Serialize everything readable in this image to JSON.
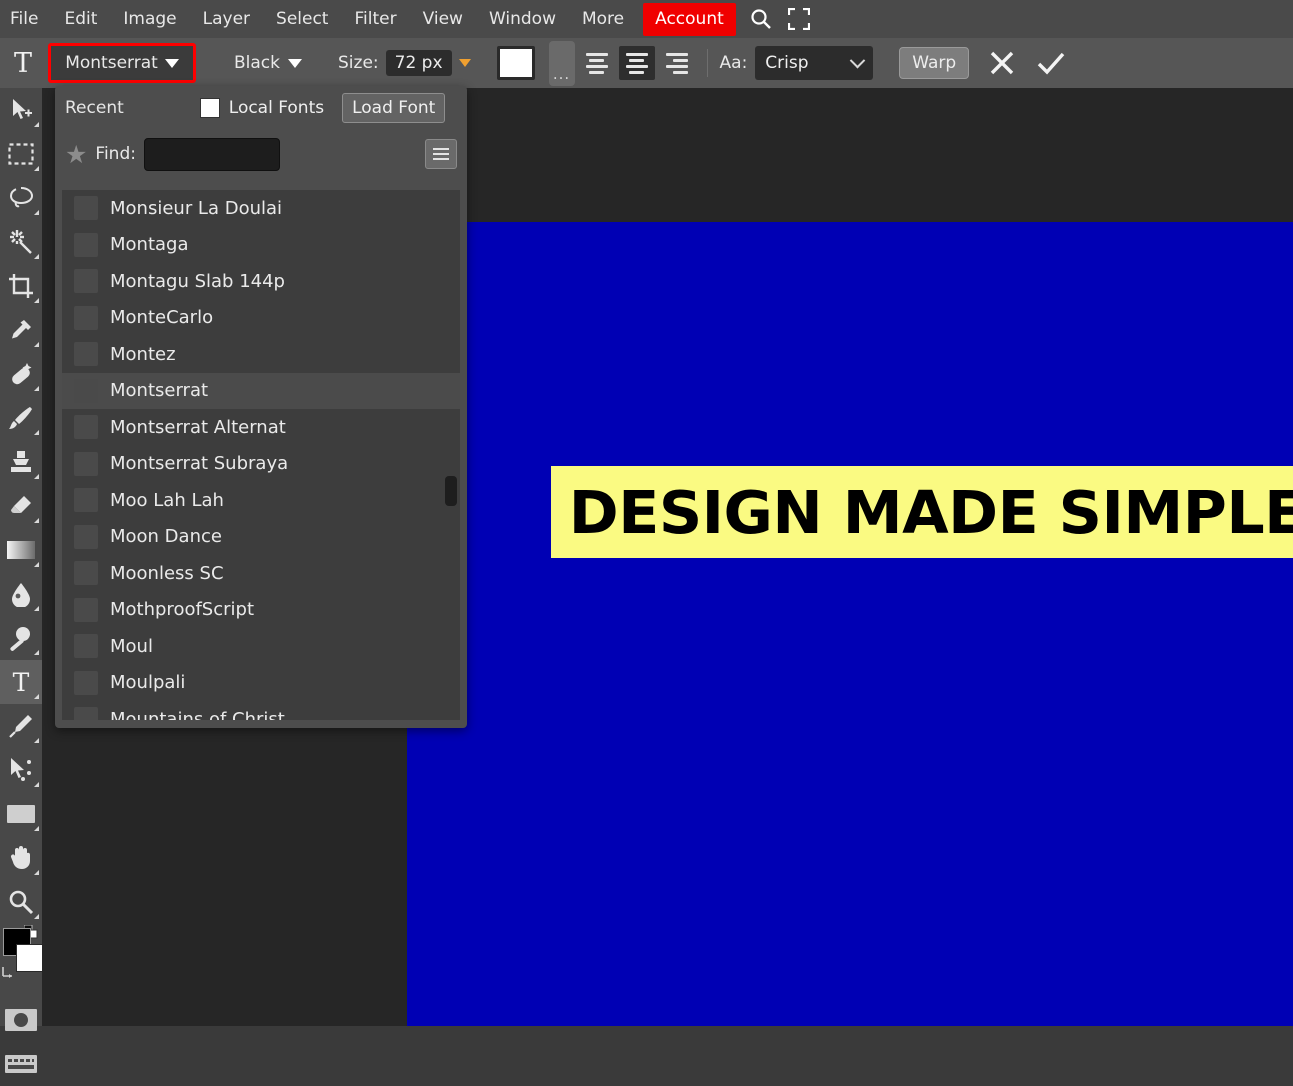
{
  "menubar": {
    "items": [
      {
        "label": "File"
      },
      {
        "label": "Edit"
      },
      {
        "label": "Image"
      },
      {
        "label": "Layer"
      },
      {
        "label": "Select"
      },
      {
        "label": "Filter"
      },
      {
        "label": "View"
      },
      {
        "label": "Window"
      },
      {
        "label": "More"
      }
    ],
    "account_label": "Account",
    "account_color": "#f00000",
    "search_icon": "search-icon",
    "fullscreen_icon": "fullscreen-icon"
  },
  "optionsbar": {
    "tool_icon_glyph": "T",
    "font_family": "Montserrat",
    "font_family_highlight_color": "#ff0000",
    "font_style": "Black",
    "size_label": "Size:",
    "size_value": "72 px",
    "color_swatch": "#ffffff",
    "more_button_label": "...",
    "align_left": "align-left",
    "align_center": "align-center",
    "align_right": "align-right",
    "aa_label": "Aa:",
    "aa_value": "Crisp",
    "aa_options": [
      "Crisp"
    ],
    "warp_label": "Warp",
    "cancel_icon": "cancel-icon",
    "commit_icon": "commit-icon"
  },
  "toolbar": {
    "tools": [
      {
        "name": "move-tool"
      },
      {
        "name": "rectangular-marquee-tool"
      },
      {
        "name": "lasso-tool"
      },
      {
        "name": "magic-wand-tool"
      },
      {
        "name": "crop-tool"
      },
      {
        "name": "eyedropper-tool"
      },
      {
        "name": "healing-brush-tool"
      },
      {
        "name": "brush-tool"
      },
      {
        "name": "clone-stamp-tool"
      },
      {
        "name": "eraser-tool"
      },
      {
        "name": "gradient-tool"
      },
      {
        "name": "blur-tool"
      },
      {
        "name": "dodge-tool"
      },
      {
        "name": "type-tool"
      },
      {
        "name": "pen-tool"
      },
      {
        "name": "path-selection-tool"
      },
      {
        "name": "rectangle-tool"
      },
      {
        "name": "hand-tool"
      },
      {
        "name": "zoom-tool"
      }
    ],
    "active_tool": "type-tool",
    "foreground_color": "#000000",
    "background_color": "#ffffff",
    "quick_mask_icon": "quick-mask-icon",
    "screen_mode_icon": "screen-mode-icon"
  },
  "font_panel": {
    "recent_label": "Recent",
    "local_fonts_label": "Local Fonts",
    "local_fonts_checked": false,
    "load_font_label": "Load Font",
    "favorites_icon": "star-icon",
    "find_label": "Find:",
    "find_value": "",
    "find_placeholder": "",
    "menu_icon": "hamburger-icon",
    "selected_font": "Montserrat",
    "fonts": [
      {
        "label": "Monsieur La Doulai"
      },
      {
        "label": "Montaga"
      },
      {
        "label": "Montagu Slab 144p"
      },
      {
        "label": "MonteCarlo"
      },
      {
        "label": "Montez"
      },
      {
        "label": "Montserrat"
      },
      {
        "label": "Montserrat Alternat"
      },
      {
        "label": "Montserrat Subraya"
      },
      {
        "label": "Moo Lah Lah"
      },
      {
        "label": "Moon Dance"
      },
      {
        "label": "Moonless SC"
      },
      {
        "label": "MothproofScript"
      },
      {
        "label": "Moul"
      },
      {
        "label": "Moulpali"
      },
      {
        "label": "Mountains of Christ"
      }
    ]
  },
  "canvas": {
    "background_color": "#0000b4",
    "banner_color": "#fafa82",
    "text": "DESIGN MADE SIMPLE",
    "text_color": "#000000"
  }
}
